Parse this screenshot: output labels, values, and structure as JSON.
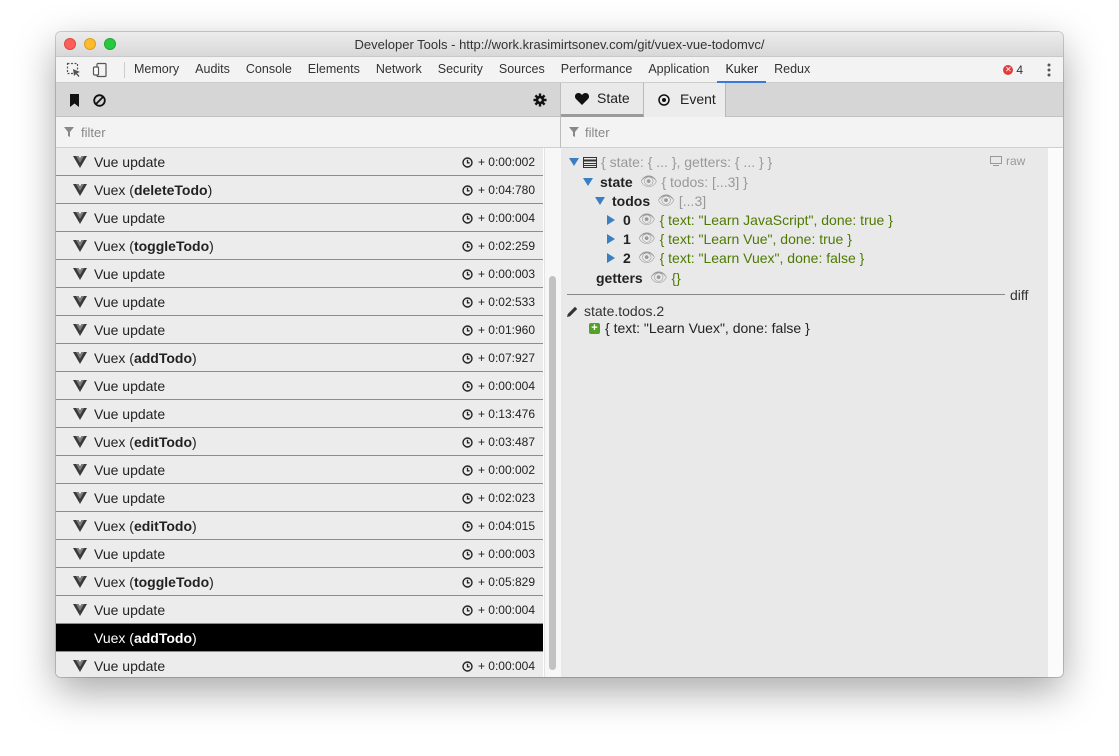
{
  "window": {
    "title": "Developer Tools - http://work.krasimirtsonev.com/git/vuex-vue-todomvc/"
  },
  "toolbar": {
    "tabs": [
      "Memory",
      "Audits",
      "Console",
      "Elements",
      "Network",
      "Security",
      "Sources",
      "Performance",
      "Application",
      "Kuker",
      "Redux"
    ],
    "active_tab": "Kuker",
    "error_count": "4",
    "accent_color": "#3879d9",
    "error_color": "#e03e3e"
  },
  "left": {
    "filter_placeholder": "filter",
    "events": [
      {
        "prefix": "Vue update",
        "action": "",
        "suffix": "",
        "time": "+ 0:00:002"
      },
      {
        "prefix": "Vuex (",
        "action": "deleteTodo",
        "suffix": ")",
        "time": "+ 0:04:780"
      },
      {
        "prefix": "Vue update",
        "action": "",
        "suffix": "",
        "time": "+ 0:00:004"
      },
      {
        "prefix": "Vuex (",
        "action": "toggleTodo",
        "suffix": ")",
        "time": "+ 0:02:259"
      },
      {
        "prefix": "Vue update",
        "action": "",
        "suffix": "",
        "time": "+ 0:00:003"
      },
      {
        "prefix": "Vue update",
        "action": "",
        "suffix": "",
        "time": "+ 0:02:533"
      },
      {
        "prefix": "Vue update",
        "action": "",
        "suffix": "",
        "time": "+ 0:01:960"
      },
      {
        "prefix": "Vuex (",
        "action": "addTodo",
        "suffix": ")",
        "time": "+ 0:07:927"
      },
      {
        "prefix": "Vue update",
        "action": "",
        "suffix": "",
        "time": "+ 0:00:004"
      },
      {
        "prefix": "Vue update",
        "action": "",
        "suffix": "",
        "time": "+ 0:13:476"
      },
      {
        "prefix": "Vuex (",
        "action": "editTodo",
        "suffix": ")",
        "time": "+ 0:03:487"
      },
      {
        "prefix": "Vue update",
        "action": "",
        "suffix": "",
        "time": "+ 0:00:002"
      },
      {
        "prefix": "Vue update",
        "action": "",
        "suffix": "",
        "time": "+ 0:02:023"
      },
      {
        "prefix": "Vuex (",
        "action": "editTodo",
        "suffix": ")",
        "time": "+ 0:04:015"
      },
      {
        "prefix": "Vue update",
        "action": "",
        "suffix": "",
        "time": "+ 0:00:003"
      },
      {
        "prefix": "Vuex (",
        "action": "toggleTodo",
        "suffix": ")",
        "time": "+ 0:05:829"
      },
      {
        "prefix": "Vue update",
        "action": "",
        "suffix": "",
        "time": "+ 0:00:004"
      },
      {
        "prefix": "Vuex (",
        "action": "addTodo",
        "suffix": ")",
        "time": "",
        "selected": true
      },
      {
        "prefix": "Vue update",
        "action": "",
        "suffix": "",
        "time": "+ 0:00:004"
      }
    ]
  },
  "right": {
    "tab_state": "State",
    "tab_event": "Event",
    "filter_placeholder": "filter",
    "root_summary": "{ state: { ... }, getters: { ... } }",
    "raw_label": "raw",
    "state_key": "state",
    "state_summary": "{ todos: [...3] }",
    "todos_key": "todos",
    "todos_summary": "[...3]",
    "todo_items": [
      {
        "index": "0",
        "value": "{ text: \"Learn JavaScript\", done: true }"
      },
      {
        "index": "1",
        "value": "{ text: \"Learn Vue\", done: true }"
      },
      {
        "index": "2",
        "value": "{ text: \"Learn Vuex\", done: false }"
      }
    ],
    "getters_key": "getters",
    "getters_value": "{}",
    "diff_label": "diff",
    "diff_path": "state.todos.2",
    "diff_added": "{ text: \"Learn Vuex\", done: false }"
  }
}
